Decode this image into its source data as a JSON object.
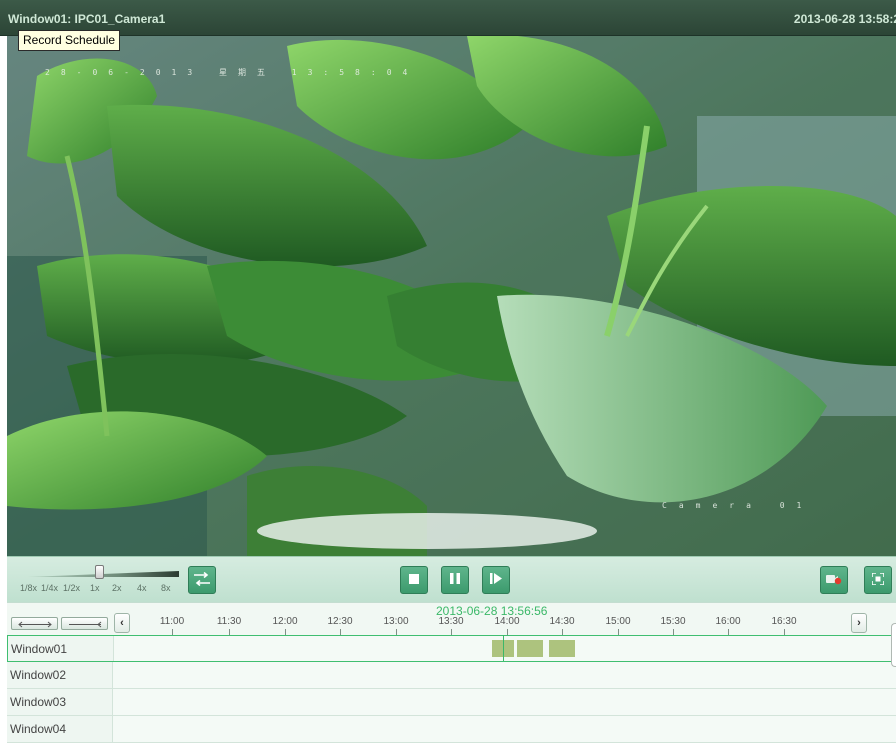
{
  "window": {
    "title": "Window01: IPC01_Camera1",
    "timestamp": "2013-06-28 13:58:2",
    "tooltip": "Record Schedule"
  },
  "video": {
    "osd_date": "28-06-2013 星期五 13:58:04",
    "osd_camera": "Camera 01"
  },
  "controls": {
    "speed_labels": [
      "1/8x",
      "1/4x",
      "1/2x",
      "1x",
      "2x",
      "4x",
      "8x"
    ],
    "speed_selected": "1x",
    "buttons": {
      "mode_icon": "switch-arrows-icon",
      "stop_icon": "stop-icon",
      "pause_icon": "pause-icon",
      "step_icon": "step-forward-icon",
      "record_icon": "record-clip-icon",
      "fullscreen_icon": "fullscreen-icon"
    }
  },
  "timeline": {
    "cursor_time": "2013-06-28 13:56:56",
    "ticks": [
      "11:00",
      "11:30",
      "12:00",
      "12:30",
      "13:00",
      "13:30",
      "14:00",
      "14:30",
      "15:00",
      "15:30",
      "16:00",
      "16:30"
    ],
    "rows": [
      "Window01",
      "Window02",
      "Window03",
      "Window04"
    ],
    "selected_row": "Window01",
    "record_color": "#adc37e",
    "accent_color": "#3bb868"
  }
}
